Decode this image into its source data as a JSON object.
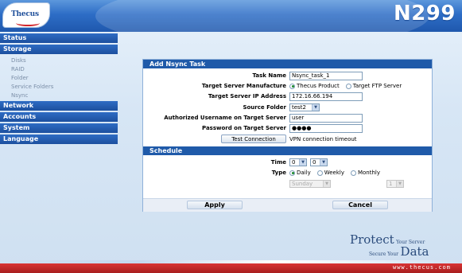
{
  "header": {
    "logo_text": "Thecus",
    "model": "N299"
  },
  "sidebar": {
    "status": "Status",
    "storage": "Storage",
    "storage_items": [
      "Disks",
      "RAID",
      "Folder",
      "Service Folders",
      "Nsync"
    ],
    "network": "Network",
    "accounts": "Accounts",
    "system": "System",
    "language": "Language"
  },
  "form": {
    "title": "Add Nsync Task",
    "task_name_label": "Task Name",
    "task_name_value": "Nsync_task_1",
    "manufacture_label": "Target Server Manufacture",
    "manufacture_opt_thecus": "Thecus Product",
    "manufacture_opt_ftp": "Target FTP Server",
    "ip_label": "Target Server IP Address",
    "ip_value": "172.16.66.194",
    "source_folder_label": "Source Folder",
    "source_folder_value": "test2",
    "username_label": "Authorized Username on Target Server",
    "username_value": "user",
    "password_label": "Password on Target Server",
    "password_value": "●●●●",
    "test_button": "Test Connection",
    "test_result": "VPN connection timeout"
  },
  "schedule": {
    "title": "Schedule",
    "time_label": "Time",
    "hour": "0",
    "minute": "0",
    "type_label": "Type",
    "type_daily": "Daily",
    "type_weekly": "Weekly",
    "type_monthly": "Monthly",
    "weekday": "Sunday",
    "monthday": "1"
  },
  "actions": {
    "apply": "Apply",
    "cancel": "Cancel"
  },
  "branding": {
    "tag_protect": "Protect",
    "tag_your_server": "Your Server",
    "tag_secure": "Secure Your",
    "tag_data": "Data",
    "url": "www.thecus.com"
  }
}
